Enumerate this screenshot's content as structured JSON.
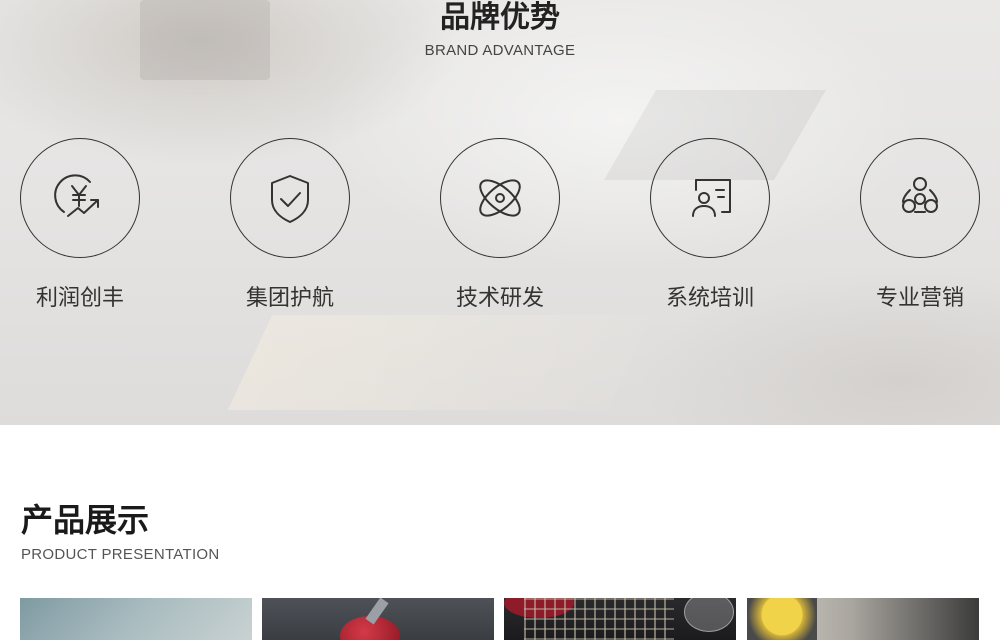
{
  "brand_section": {
    "title": "品牌优势",
    "subtitle": "BRAND ADVANTAGE",
    "items": [
      {
        "label": "利润创丰",
        "icon": "yen-growth-icon"
      },
      {
        "label": "集团护航",
        "icon": "shield-check-icon"
      },
      {
        "label": "技术研发",
        "icon": "atom-icon"
      },
      {
        "label": "系统培训",
        "icon": "presentation-icon"
      },
      {
        "label": "专业营销",
        "icon": "network-icon"
      }
    ]
  },
  "product_section": {
    "title": "产品展示",
    "subtitle": "PRODUCT PRESENTATION",
    "thumbnails": [
      {
        "image": "product-photo-1"
      },
      {
        "image": "product-photo-2"
      },
      {
        "image": "product-photo-3"
      },
      {
        "image": "product-photo-4"
      }
    ]
  },
  "colors": {
    "text_dark": "#222222",
    "circle_border": "#333333",
    "section_bg": "#e6e5e4"
  }
}
